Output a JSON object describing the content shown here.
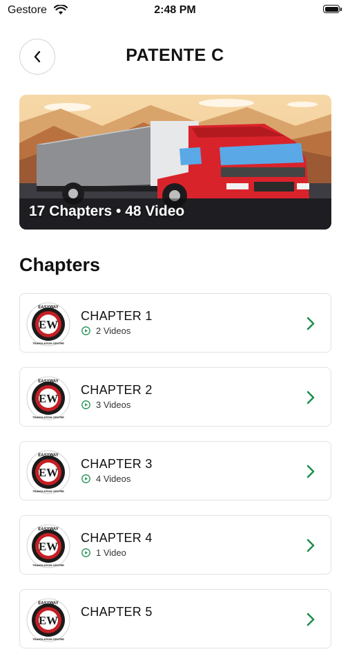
{
  "status_bar": {
    "carrier": "Gestore",
    "time": "2:48 PM"
  },
  "header": {
    "title": "PATENTE C"
  },
  "banner": {
    "caption": "17 Chapters • 48 Video"
  },
  "section_title": "Chapters",
  "logo_text": {
    "top": "EASYWAY",
    "mark": "EW",
    "bottom": "TRANSLATION CENTRE"
  },
  "chapters": [
    {
      "title": "CHAPTER 1",
      "videos": "2 Videos"
    },
    {
      "title": "CHAPTER 2",
      "videos": "3 Videos"
    },
    {
      "title": "CHAPTER 3",
      "videos": "4 Videos"
    },
    {
      "title": "CHAPTER 4",
      "videos": "1 Video"
    },
    {
      "title": "CHAPTER 5",
      "videos": ""
    }
  ],
  "colors": {
    "accent": "#1e8f4e",
    "truck_red": "#d9232b"
  }
}
